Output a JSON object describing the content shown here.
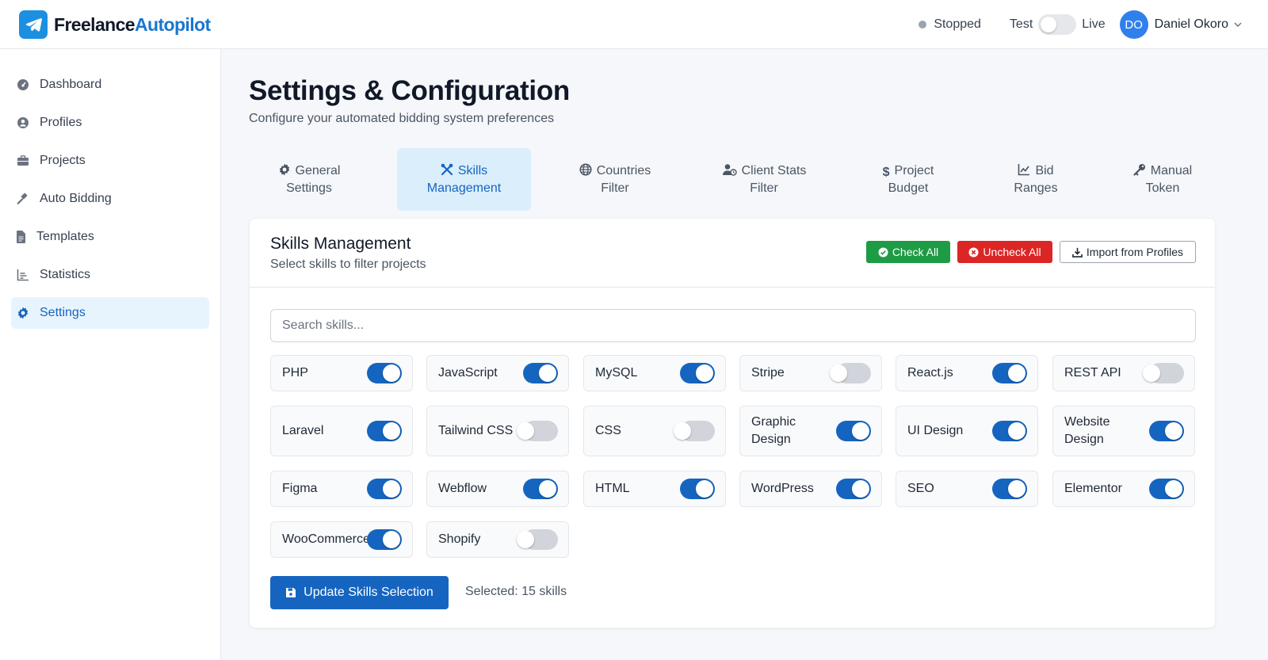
{
  "brand": {
    "part1": "Freelance",
    "part2": "Autopilot"
  },
  "header": {
    "status": "Stopped",
    "mode_test": "Test",
    "mode_live": "Live",
    "user_initials": "DO",
    "user_name": "Daniel Okoro"
  },
  "sidebar": {
    "items": [
      {
        "label": "Dashboard",
        "icon": "dashboard-icon"
      },
      {
        "label": "Profiles",
        "icon": "user-circle-icon"
      },
      {
        "label": "Projects",
        "icon": "briefcase-icon"
      },
      {
        "label": "Auto Bidding",
        "icon": "gavel-icon"
      },
      {
        "label": "Templates",
        "icon": "file-icon"
      },
      {
        "label": "Statistics",
        "icon": "chart-icon"
      },
      {
        "label": "Settings",
        "icon": "gear-icon",
        "active": true
      }
    ]
  },
  "page": {
    "title": "Settings & Configuration",
    "subtitle": "Configure your automated bidding system preferences"
  },
  "tabs": [
    {
      "line1": "General",
      "line2": "Settings",
      "icon": "gear-icon"
    },
    {
      "line1": "Skills",
      "line2": "Management",
      "icon": "tools-icon",
      "active": true
    },
    {
      "line1": "Countries",
      "line2": "Filter",
      "icon": "globe-icon"
    },
    {
      "line1": "Client Stats",
      "line2": "Filter",
      "icon": "user-check-icon"
    },
    {
      "line1": "Project",
      "line2": "Budget",
      "icon": "dollar-icon"
    },
    {
      "line1": "Bid",
      "line2": "Ranges",
      "icon": "line-chart-icon"
    },
    {
      "line1": "Manual",
      "line2": "Token",
      "icon": "key-icon"
    }
  ],
  "card": {
    "title": "Skills Management",
    "subtitle": "Select skills to filter projects",
    "check_all": "Check All",
    "uncheck_all": "Uncheck All",
    "import": "Import from Profiles",
    "search_placeholder": "Search skills...",
    "update_button": "Update Skills Selection",
    "selected_text": "Selected: 15 skills"
  },
  "skills": [
    {
      "name": "PHP",
      "on": true
    },
    {
      "name": "JavaScript",
      "on": true
    },
    {
      "name": "MySQL",
      "on": true
    },
    {
      "name": "Stripe",
      "on": false
    },
    {
      "name": "React.js",
      "on": true
    },
    {
      "name": "REST API",
      "on": false
    },
    {
      "name": "Laravel",
      "on": true
    },
    {
      "name": "Tailwind CSS",
      "on": false
    },
    {
      "name": "CSS",
      "on": false
    },
    {
      "name": "Graphic Design",
      "on": true
    },
    {
      "name": "UI Design",
      "on": true
    },
    {
      "name": "Website Design",
      "on": true
    },
    {
      "name": "Figma",
      "on": true
    },
    {
      "name": "Webflow",
      "on": true
    },
    {
      "name": "HTML",
      "on": true
    },
    {
      "name": "WordPress",
      "on": true
    },
    {
      "name": "SEO",
      "on": true
    },
    {
      "name": "Elementor",
      "on": true
    },
    {
      "name": "WooCommerce",
      "on": true
    },
    {
      "name": "Shopify",
      "on": false
    }
  ],
  "colors": {
    "primary": "#1565c0",
    "success": "#1e9b45",
    "danger": "#dc2626",
    "active_bg": "#e8f4fd"
  }
}
